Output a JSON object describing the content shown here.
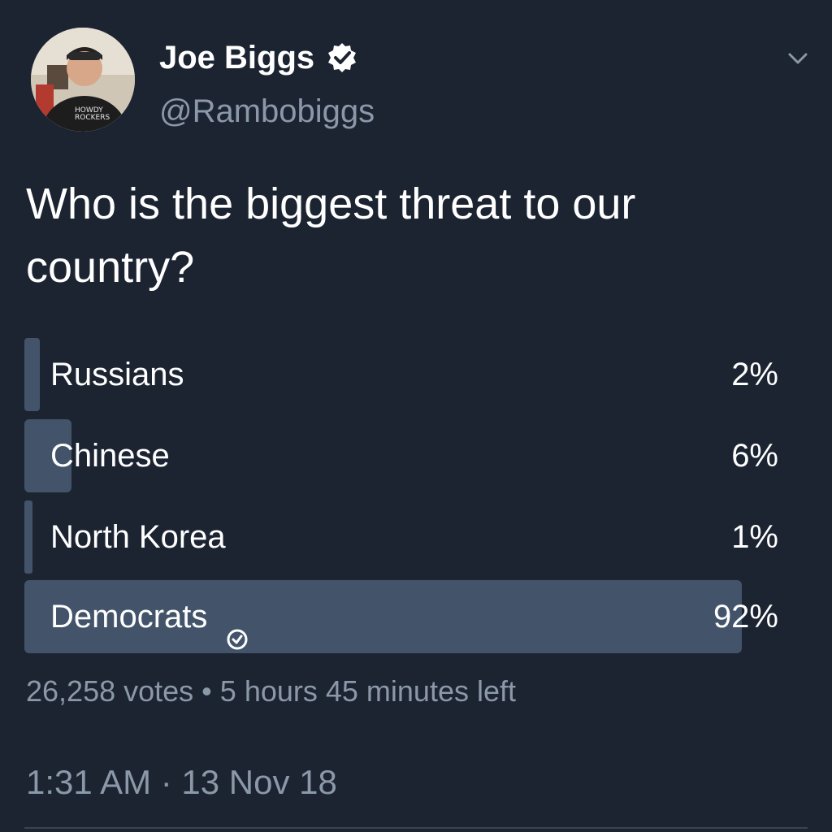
{
  "author": {
    "display_name": "Joe Biggs",
    "handle": "@Rambobiggs",
    "verified": true,
    "avatar_icon": "profile-photo"
  },
  "tweet": {
    "text": "Who is the biggest threat to our country?",
    "timestamp": "1:31 AM · 13 Nov 18"
  },
  "poll": {
    "options": [
      {
        "label": "Russians",
        "percent_text": "2%",
        "percent": 2,
        "selected": false
      },
      {
        "label": "Chinese",
        "percent_text": "6%",
        "percent": 6,
        "selected": false
      },
      {
        "label": "North Korea",
        "percent_text": "1%",
        "percent": 1,
        "selected": false
      },
      {
        "label": "Democrats",
        "percent_text": "92%",
        "percent": 92,
        "selected": true
      }
    ],
    "votes": "26,258 votes",
    "separator": "•",
    "time_left": "5 hours 45 minutes left"
  },
  "colors": {
    "background": "#1c2432",
    "bar": "#43546a",
    "secondary_text": "#8b98a8"
  }
}
